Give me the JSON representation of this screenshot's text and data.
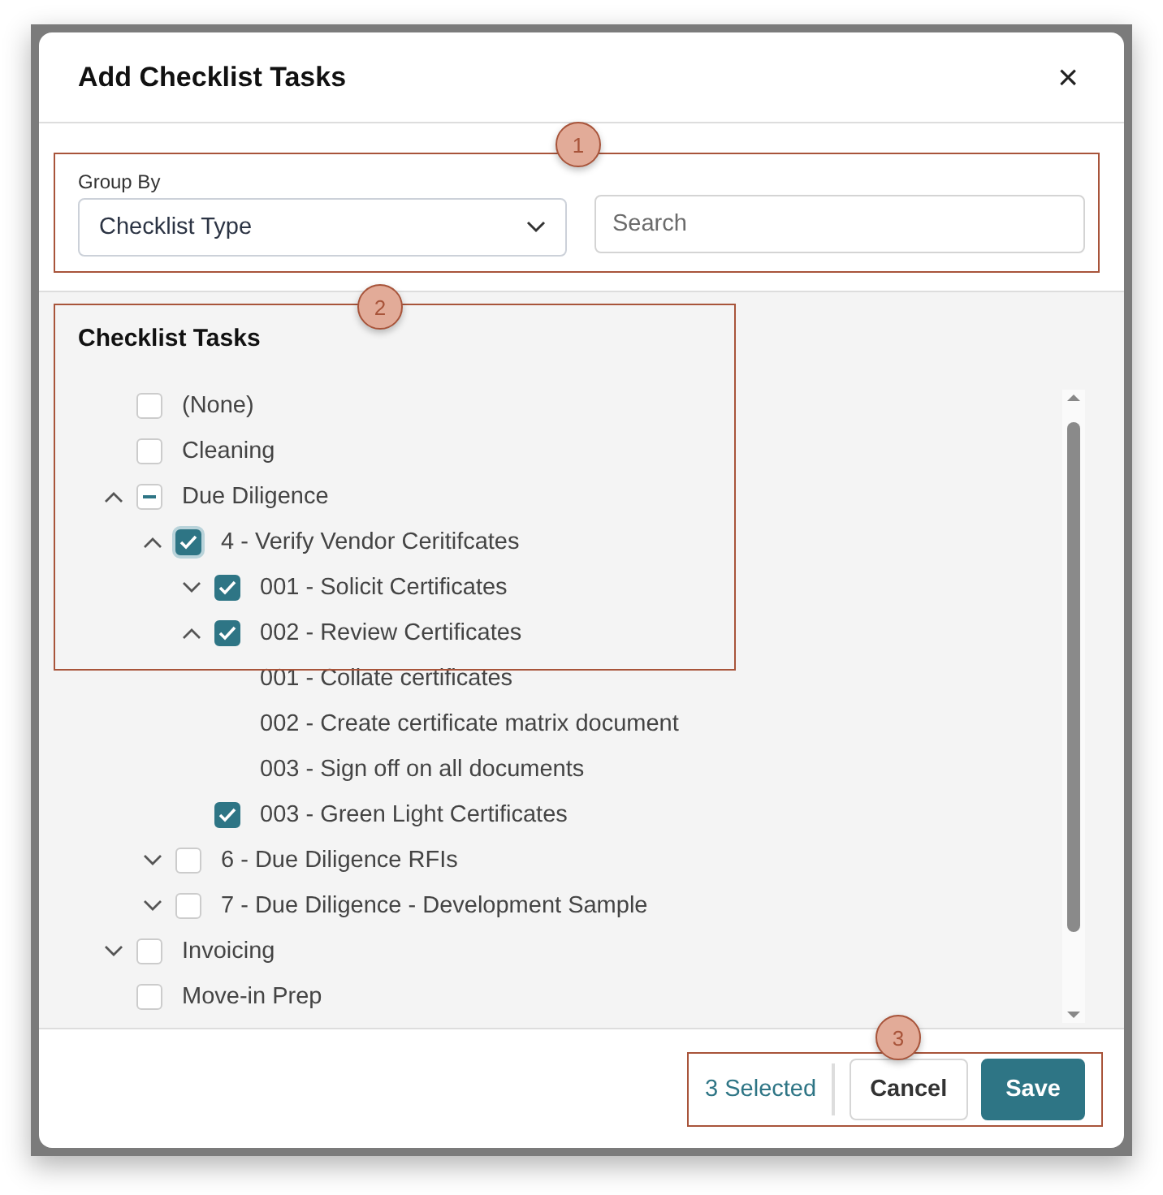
{
  "dialog": {
    "title": "Add Checklist Tasks",
    "close_label": "×"
  },
  "filters": {
    "group_by_label": "Group By",
    "group_by_value": "Checklist Type",
    "search": {
      "placeholder": "Search"
    }
  },
  "tasks_title": "Checklist Tasks",
  "tasks": [
    {
      "label": "(None)",
      "kind": "check",
      "checked": false
    },
    {
      "label": "Cleaning",
      "kind": "check",
      "checked": false
    },
    {
      "label": "Due Diligence",
      "kind": "check",
      "checked": true,
      "partial": true,
      "expanded": true,
      "children": [
        {
          "label": "4 - Verify Vendor Ceritifcates",
          "kind": "check",
          "checked": true,
          "focused": true,
          "expanded": true,
          "children": [
            {
              "label": "001 - Solicit Certificates",
              "kind": "check",
              "checked": true,
              "expanded": false
            },
            {
              "label": "002 - Review Certificates",
              "kind": "check",
              "checked": true,
              "expanded": true,
              "children": [
                {
                  "label": "001 - Collate certificates",
                  "kind": "text"
                },
                {
                  "label": "002 - Create certificate matrix document",
                  "kind": "text"
                },
                {
                  "label": "003 - Sign off on all documents",
                  "kind": "text"
                }
              ]
            },
            {
              "label": "003 - Green Light Certificates",
              "kind": "check",
              "checked": true
            }
          ]
        },
        {
          "label": "6 - Due Diligence RFIs",
          "kind": "check",
          "checked": false,
          "expanded": false
        },
        {
          "label": "7 - Due Diligence - Development Sample",
          "kind": "check",
          "checked": false,
          "expanded": false
        }
      ]
    },
    {
      "label": "Invoicing",
      "kind": "check",
      "checked": false,
      "expanded": false
    },
    {
      "label": "Move-in Prep",
      "kind": "check",
      "checked": false
    }
  ],
  "footer": {
    "selected_count": "3 Selected",
    "buttons": [
      "Cancel",
      "Save"
    ]
  },
  "callouts": [
    "1",
    "2",
    "3"
  ]
}
